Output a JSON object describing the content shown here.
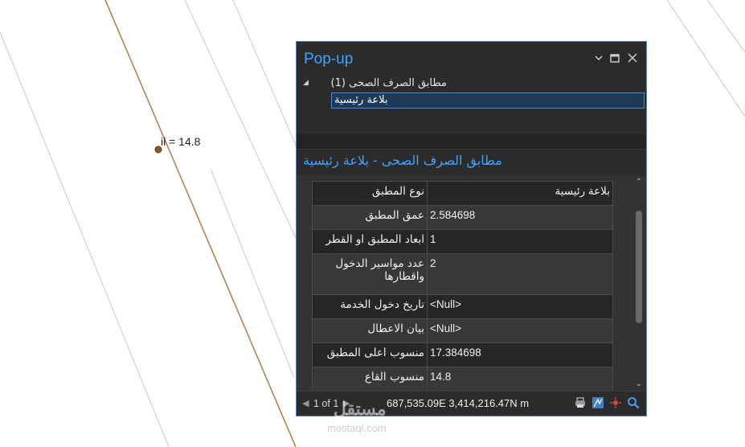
{
  "map": {
    "label": "il = 14.8"
  },
  "popup": {
    "title": "Pop-up",
    "tree": {
      "group_label": "مطابق الصرف الصحى (1)",
      "selected_item": "بلاعة رئيسية"
    },
    "feature_title": "مطابق الصرف الصحى - بلاعة رئيسية",
    "attributes": [
      {
        "field": "نوع المطبق",
        "value": "بلاعة رئيسية"
      },
      {
        "field": "عمق المطبق",
        "value": "2.584698"
      },
      {
        "field": "ابعاد المطبق او القطر",
        "value": "1"
      },
      {
        "field": "عدد مواسير الدخول واقطارها",
        "value": "2"
      },
      {
        "field": "تاريخ دخول الخدمة",
        "value": "<Null>"
      },
      {
        "field": "بيان الاعطال",
        "value": "<Null>"
      },
      {
        "field": "منسوب اعلى المطبق",
        "value": "17.384698"
      },
      {
        "field": "منسوب القاع",
        "value": "14.8"
      }
    ],
    "status": {
      "page_text": "1 of 1",
      "coordinates": "687,535.09E 3,414,216.47N m"
    },
    "icons": {
      "status_icons": [
        "print-icon",
        "map-navigate-icon",
        "flash-icon",
        "zoom-to-icon"
      ],
      "title_icons": [
        "chevron-down-icon",
        "restore-icon",
        "close-icon"
      ]
    },
    "colors": {
      "accent": "#3fa3ff",
      "panel": "#2b2b2b",
      "line": "#b5834e"
    }
  },
  "watermark": {
    "arabic": "مستقل",
    "english": "mostaql.com"
  }
}
